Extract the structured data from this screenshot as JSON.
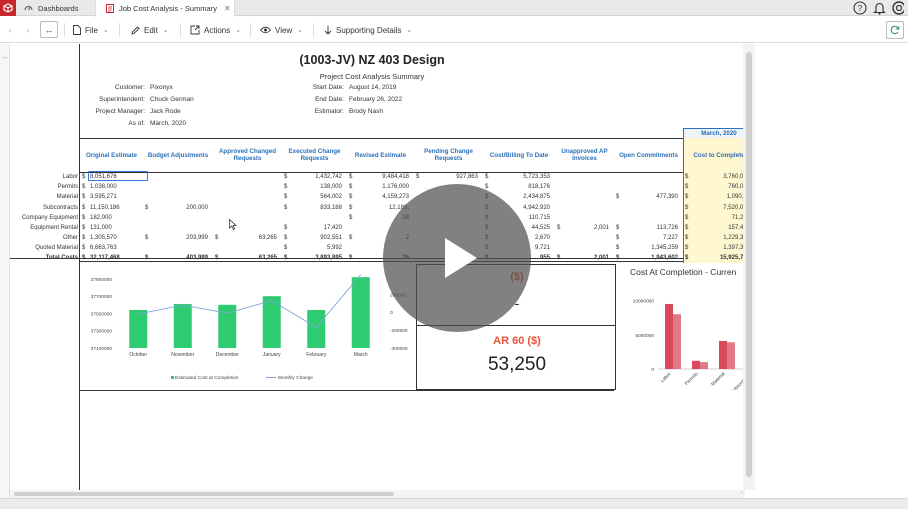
{
  "tabs": [
    {
      "label": "Dashboards"
    },
    {
      "label": "Job Cost Analysis - Summary"
    }
  ],
  "toolbar": {
    "file": "File",
    "edit": "Edit",
    "actions": "Actions",
    "view": "View",
    "supporting": "Supporting Details"
  },
  "report": {
    "title": "(1003-JV) NZ 403 Design",
    "subtitle": "Project Cost Analysis Summary",
    "customer_label": "Customer:",
    "customer": "Pixonyx",
    "superintendent_label": "Superintendent:",
    "superintendent": "Chuck German",
    "pm_label": "Project Manager:",
    "pm": "Jack Rode",
    "asof_label": "As of:",
    "asof": "March, 2020",
    "start_label": "Start Date:",
    "start": "August 14, 2019",
    "end_label": "End Date:",
    "end": "February 26, 2022",
    "estimator_label": "Estimator:",
    "estimator": "Brody Nash",
    "period_header": "March, 2020",
    "columns": [
      "Original Estimate",
      "Budget Adjustments",
      "Approved Changed Requests",
      "Executed Change Requests",
      "Revised Estimate",
      "Pending Change Requests",
      "Cost/Billing To Date",
      "Unapproved AP Invoices",
      "Open Commitments",
      "Cost to Complete"
    ],
    "rows": [
      {
        "label": "Labor",
        "c": [
          "8,051,676",
          "",
          "",
          "1,432,742",
          "9,484,418",
          "927,863",
          "5,723,353",
          "",
          "",
          "3,760,000"
        ]
      },
      {
        "label": "Permits",
        "c": [
          "1,038,000",
          "",
          "",
          "138,000",
          "1,176,000",
          "",
          "818,176",
          "",
          "",
          "760,000"
        ]
      },
      {
        "label": "Material",
        "c": [
          "3,595,271",
          "",
          "",
          "564,002",
          "4,159,273",
          "",
          "2,434,875",
          "",
          "477,390",
          "1,090,31"
        ]
      },
      {
        "label": "Subcontracts",
        "c": [
          "11,150,186",
          "200,000",
          "",
          "833,188",
          "12,183,",
          "",
          "4,942,920",
          "",
          "",
          "7,520,000"
        ]
      },
      {
        "label": "Company Equipment",
        "c": [
          "182,000",
          "",
          "",
          "",
          "18",
          "",
          "110,715",
          "",
          "",
          "71,285"
        ]
      },
      {
        "label": "Equipment Rental",
        "c": [
          "131,000",
          "",
          "",
          "17,420",
          "",
          "",
          "44,525",
          "2,001",
          "113,726",
          "157,439"
        ]
      },
      {
        "label": "Other",
        "c": [
          "1,305,570",
          "203,999",
          "63,265",
          "902,551",
          "2",
          "",
          "2,670",
          "",
          "7,227",
          "1,229,300"
        ]
      },
      {
        "label": "Quoted Material",
        "c": [
          "6,663,763",
          "",
          "",
          "5,992",
          "",
          "",
          "9,721",
          "",
          "1,345,259",
          "1,397,379"
        ]
      }
    ],
    "totals": {
      "label": "Total Costs",
      "c": [
        "32,117,468",
        "403,999",
        "63,265",
        "3,893,895",
        "36",
        "",
        "955",
        "2,001",
        "1,943,602",
        "15,925,712"
      ]
    }
  },
  "chart_data": [
    {
      "type": "bar",
      "title": "",
      "categories": [
        "October",
        "November",
        "December",
        "January",
        "February",
        "March"
      ],
      "series": [
        {
          "name": "Estimated Cost at Completion",
          "type": "bar",
          "color": "#2ecc71",
          "values": [
            37540000,
            37610000,
            37600000,
            37700000,
            37540000,
            37920000
          ]
        },
        {
          "name": "Monthly Change",
          "type": "line",
          "color": "#7fa6d9",
          "values": [
            -20000,
            80000,
            -10000,
            130000,
            -170000,
            420000
          ]
        }
      ],
      "y_ticks": [
        "37100000",
        "37300000",
        "37500000",
        "37700000",
        "37900000"
      ],
      "y2_ticks": [
        "-400000",
        "-200000",
        "0",
        "200000"
      ],
      "ylim": [
        37100000,
        37980000
      ]
    },
    {
      "type": "bar",
      "title": "Cost At Completion - Curren",
      "categories": [
        "Labor",
        "Permits",
        "Material",
        "Subcontracts"
      ],
      "series": [
        {
          "name": "",
          "color": "#d9495b",
          "values": [
            9500000,
            1200000,
            4100000,
            12300000
          ]
        },
        {
          "name": "",
          "color": "#e07a86",
          "values": [
            8000000,
            1000000,
            3900000,
            0
          ]
        }
      ],
      "y_ticks": [
        "0",
        "5000000",
        "10000000"
      ],
      "ylim": [
        0,
        13000000
      ]
    }
  ],
  "ar": {
    "top_label": "($)",
    "top_value": "-",
    "ar60_label": "AR 60 ($)",
    "ar60_value": "53,250"
  },
  "colors": {
    "accent": "#2b70b8",
    "brand": "#c9272e",
    "ar": "#e8533a"
  }
}
